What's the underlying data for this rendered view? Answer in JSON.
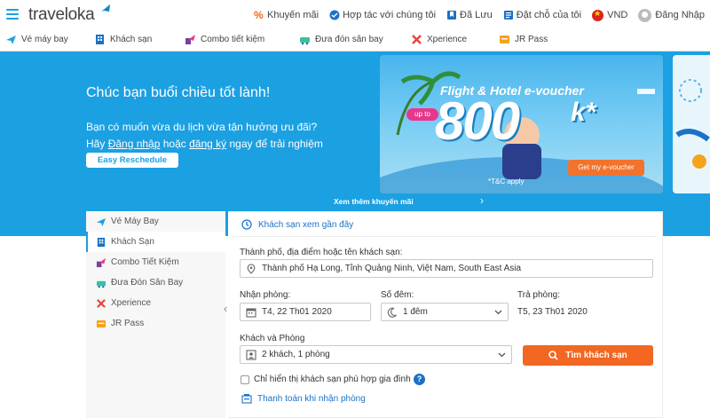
{
  "header": {
    "logo": "traveloka",
    "nav": [
      {
        "icon": "percent-icon",
        "label": "Khuyến mãi"
      },
      {
        "icon": "handshake-icon",
        "label": "Hợp tác với chúng tôi"
      },
      {
        "icon": "bookmark-icon",
        "label": "Đã Lưu"
      },
      {
        "icon": "booking-icon",
        "label": "Đặt chỗ của tôi"
      },
      {
        "icon": "vietnam-flag-icon",
        "label": "VND"
      },
      {
        "icon": "user-avatar-icon",
        "label": "Đăng Nhập"
      }
    ]
  },
  "subnav": [
    {
      "icon": "plane-icon",
      "label": "Vé máy bay"
    },
    {
      "icon": "hotel-icon",
      "label": "Khách sạn"
    },
    {
      "icon": "combo-icon",
      "label": "Combo tiết kiệm"
    },
    {
      "icon": "airport-transfer-icon",
      "label": "Đưa đón sân bay"
    },
    {
      "icon": "xperience-icon",
      "label": "Xperience"
    },
    {
      "icon": "jr-pass-icon",
      "label": "JR Pass"
    }
  ],
  "hero": {
    "greeting": "Chúc bạn buổi chiều tốt lành!",
    "line1": "Bạn có muốn vừa du lịch vừa tận hưởng ưu đãi?",
    "line2_prefix": "Hãy ",
    "line2_login": "Đăng nhập",
    "line2_mid": " hoặc ",
    "line2_register": "đăng ký",
    "line2_suffix": " ngay để trải nghiệm",
    "reschedule_button": "Easy Reschedule",
    "more_promotions": "Xem thêm khuyến mãi",
    "banner": {
      "title": "Flight & Hotel e-voucher",
      "up_to": "up to",
      "amount": "800",
      "unit": "k*",
      "cta": "Get my e-voucher",
      "terms": "*T&C apply"
    }
  },
  "search": {
    "sidebar": [
      {
        "icon": "plane-icon",
        "label": "Vé Máy Bay",
        "active": false
      },
      {
        "icon": "hotel-icon",
        "label": "Khách Sạn",
        "active": true
      },
      {
        "icon": "combo-icon",
        "label": "Combo Tiết Kiệm",
        "active": false
      },
      {
        "icon": "airport-transfer-icon",
        "label": "Đưa Đón Sân Bay",
        "active": false
      },
      {
        "icon": "xperience-icon",
        "label": "Xperience",
        "active": false
      },
      {
        "icon": "jr-pass-icon",
        "label": "JR Pass",
        "active": false
      }
    ],
    "recent_hotels": "Khách sạn xem gần đây",
    "destination_label": "Thành phố, địa điểm hoặc tên khách sạn:",
    "destination_value": "Thành phố Hạ Long, Tỉnh Quảng Ninh, Việt Nam, South East Asia",
    "checkin_label": "Nhận phòng:",
    "checkin_value": "T4, 22 Th01 2020",
    "nights_label": "Số đêm:",
    "nights_value": "1 đêm",
    "checkout_label": "Trả phòng:",
    "checkout_value": "T5, 23 Th01 2020",
    "guests_label": "Khách và Phòng",
    "guests_value": "2 khách, 1 phòng",
    "search_button": "Tìm khách sạn",
    "family_checkbox": "Chỉ hiển thị khách sạn phù hợp gia đình",
    "pay_at_hotel": "Thanh toán khi nhận phòng"
  },
  "colors": {
    "brand": "#1ba0e2",
    "cta_orange": "#f26722",
    "link_blue": "#1b72c6"
  }
}
